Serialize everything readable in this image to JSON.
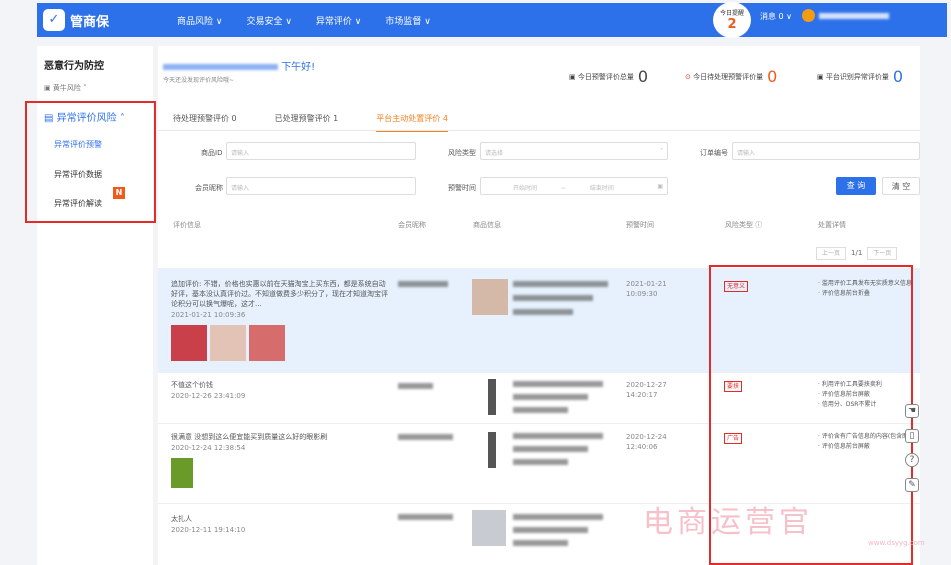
{
  "brand": {
    "name": "管商保"
  },
  "nav": [
    "商品风险 ∨",
    "交易安全 ∨",
    "异常评价 ∨",
    "市场监督 ∨"
  ],
  "warning": {
    "label": "今日提醒",
    "count": "2"
  },
  "message": "消息 0 ∨",
  "sidebar": {
    "title": "恶意行为防控",
    "sub": "黄牛风险",
    "group": "异常评价风险",
    "items": [
      {
        "label": "异常评价预警"
      },
      {
        "label": "异常评价数据"
      },
      {
        "label": "异常评价解读"
      }
    ],
    "badge": "N"
  },
  "header": {
    "greeting": "下午好!",
    "subtitle": "今天还没发现评价风险哦~",
    "stats": [
      {
        "label": "今日预警评价总量",
        "value": "0"
      },
      {
        "label": "今日待处理预警评价量",
        "value": "0"
      },
      {
        "label": "平台识别异常评价量",
        "value": "0"
      }
    ]
  },
  "tabs": [
    {
      "label": "待处理预警评价 0"
    },
    {
      "label": "已处理预警评价 1"
    },
    {
      "label": "平台主动处置评价 4"
    }
  ],
  "filters": {
    "product_id": {
      "label": "商品ID",
      "placeholder": "请输入"
    },
    "risk_type": {
      "label": "风险类型",
      "placeholder": "请选择"
    },
    "order_no": {
      "label": "订单编号",
      "placeholder": "请输入"
    },
    "member_name": {
      "label": "会员昵称",
      "placeholder": "请输入"
    },
    "warn_time": {
      "label": "预警时间",
      "start": "开始时间",
      "end": "结束时间",
      "sep": "~"
    },
    "query": "查 询",
    "clear": "清 空"
  },
  "table": {
    "headers": [
      "评价信息",
      "会员昵称",
      "商品信息",
      "预警时间",
      "风险类型 ⓘ",
      "处置详情"
    ],
    "pager": {
      "prev": "上一页",
      "page": "1/1",
      "next": "下一页"
    },
    "rows": [
      {
        "text": "追加评价: 不错，价格也实惠以前在天猫淘宝上买东西，都是系统自动好评，基本没认真评价过。不知道做费多少积分了，现在才知道淘宝评论积分可以换气爆呢，这才...",
        "time": "2021-01-21 10:09:36",
        "warn_time": "2021-01-21 10:09:30",
        "risk": "无意义",
        "details": [
          "滥用评价工具发布无实质意义信息",
          "评价信息前台折叠"
        ]
      },
      {
        "text": "不值这个价钱",
        "time": "2020-12-26 23:41:09",
        "warn_time": "2020-12-27 14:20:17",
        "risk": "要挟",
        "details": [
          "利用评价工具要挟卖利",
          "评价信息前台屏蔽",
          "信用分、DSR不累计"
        ]
      },
      {
        "text": "很满意 没想到这么便宜能买到质量这么好的眼影刷",
        "time": "2020-12-24 12:38:54",
        "warn_time": "2020-12-24 12:40:06",
        "risk": "广告",
        "details": [
          "评价含有广告信息的内容(包含图片)",
          "评价信息前台屏蔽"
        ]
      },
      {
        "text": "太扎人",
        "time": "2020-12-11 19:14:10",
        "warn_time": "",
        "risk": "",
        "details": []
      }
    ]
  },
  "watermark": {
    "text": "电商运营官",
    "sub": "www.dsyyg.com"
  },
  "colors": {
    "primary": "#2d71ea",
    "accent": "#f5811f",
    "danger": "#e52a2a"
  }
}
